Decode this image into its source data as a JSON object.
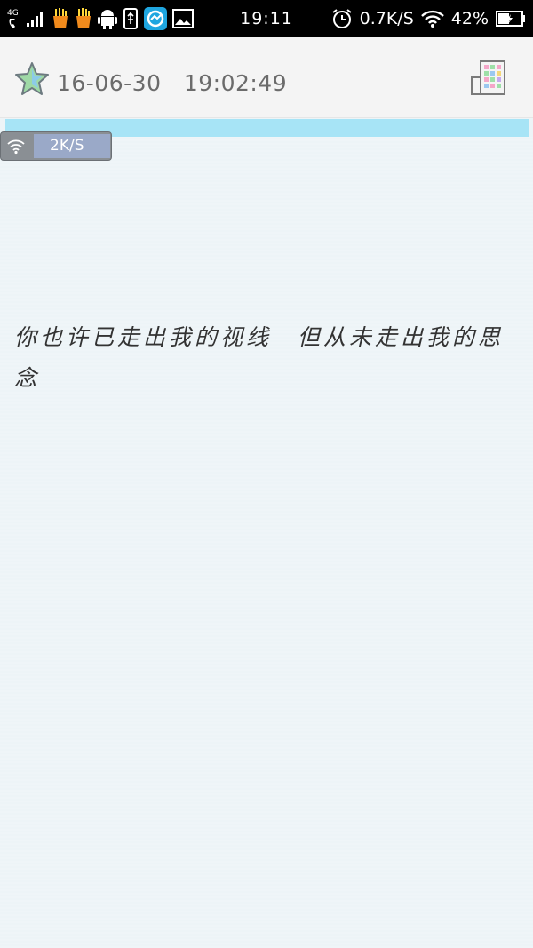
{
  "status_bar": {
    "network": "4G",
    "time": "19:11",
    "speed": "0.7K/S",
    "battery": "42%",
    "icons": [
      "call-signal-icon",
      "signal-bars-icon",
      "fries-icon",
      "fries-icon",
      "android-icon",
      "usb-icon",
      "app-icon",
      "image-icon",
      "alarm-icon",
      "wifi-icon",
      "battery-icon"
    ]
  },
  "header": {
    "date": "16-06-30",
    "time": "19:02:49"
  },
  "net_overlay": {
    "speed": "2K/S"
  },
  "note": {
    "text": "你也许已走出我的视线　但从未走出我的思念"
  },
  "colors": {
    "accent_bar": "#a7e4f6",
    "background": "#edf4f7"
  }
}
